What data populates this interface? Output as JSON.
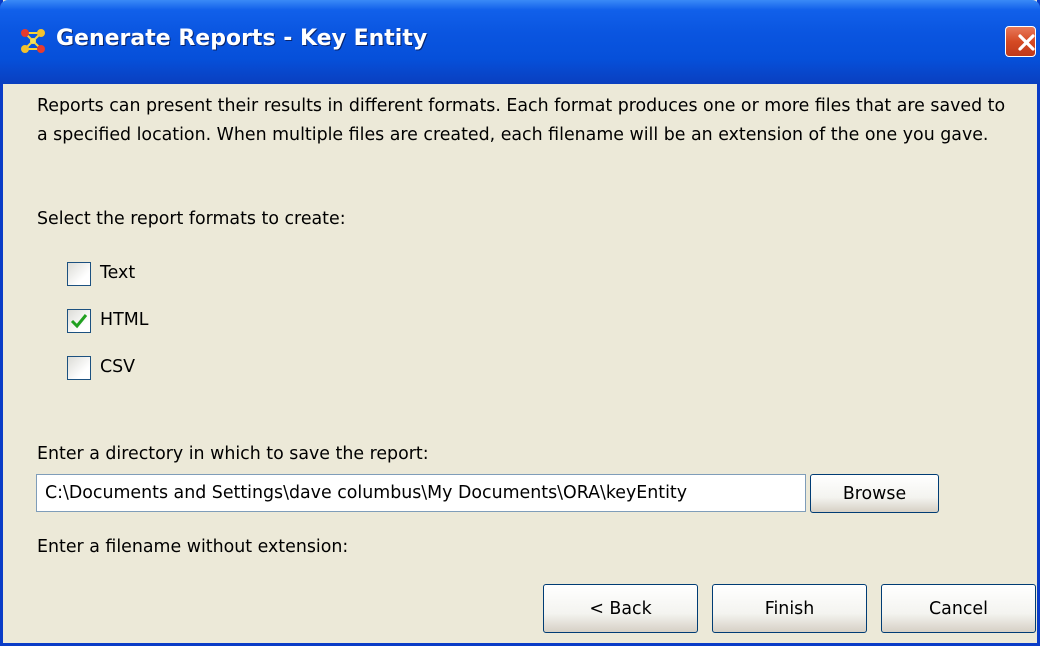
{
  "window": {
    "title": "Generate Reports - Key Entity"
  },
  "intro_text": "Reports can present their results in different formats. Each format produces one or more files that are saved to a specified location. When multiple files are created, each filename will be an extension of the one you gave.",
  "formats_prompt": "Select the report formats to create:",
  "formats": [
    {
      "label": "Text",
      "checked": false
    },
    {
      "label": "HTML",
      "checked": true
    },
    {
      "label": "CSV",
      "checked": false
    }
  ],
  "directory": {
    "prompt": "Enter a directory in which to save the report:",
    "value": "C:\\Documents and Settings\\dave columbus\\My Documents\\ORA\\keyEntity",
    "browse_label": "Browse"
  },
  "filename_prompt": "Enter a filename without extension:",
  "buttons": {
    "back": "< Back",
    "finish": "Finish",
    "cancel": "Cancel"
  },
  "colors": {
    "titlebar": "#0a55e0",
    "dialog_bg": "#ece9d8",
    "check_mark": "#21a121",
    "close_btn": "#d54a24"
  },
  "icons": {
    "app": "ora-network-icon",
    "close": "close-icon",
    "check": "check-mark-icon"
  }
}
